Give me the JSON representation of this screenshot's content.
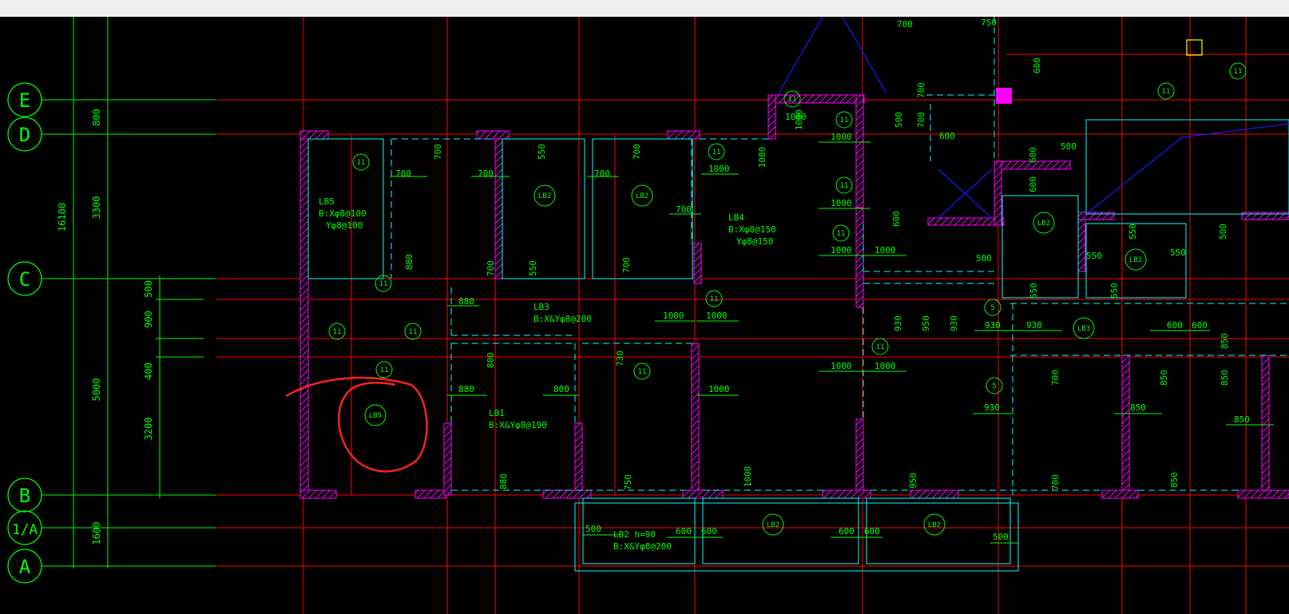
{
  "app": {
    "title": ""
  },
  "colors": {
    "background": "#000000",
    "axis": "#00ff00",
    "grid": "#ff0000",
    "wall": "#ff00ff",
    "dash": "#00ffff",
    "note": "#00ff00",
    "annotation": "#ff2222",
    "blue": "#1a1aff",
    "yellow": "#ffff00"
  },
  "axes": {
    "rows": [
      "E",
      "D",
      "C",
      "B",
      "1/A",
      "A"
    ],
    "outer_dim": "16100",
    "dims_mid": [
      "800",
      "3300",
      "5000",
      "1600"
    ],
    "dims_inner": [
      "500",
      "900",
      "400",
      "3200"
    ]
  },
  "slabs": {
    "lb5_title": "LB5",
    "lb5_x": "B:Xφ8@100",
    "lb5_y": "Yφ8@100",
    "lb4_title": "LB4",
    "lb4_x": "B:Xφ8@150",
    "lb4_y": "Yφ8@150",
    "lb3_title": "LB3",
    "lb3_x": "B:X&Yφ8@200",
    "lb1_title": "LB1",
    "lb1_x": "B:X&Yφ8@190",
    "lb2_title": "LB2  h=90",
    "lb2_x": "B:X&Yφ8@200"
  },
  "circles": {
    "lb2": "LB2",
    "lb5": "LB5",
    "lb3": "LB3",
    "n11": "11",
    "n5": "5"
  },
  "dims": {
    "d500": "500",
    "d550": "550",
    "d600": "600",
    "d700": "700",
    "d730": "730",
    "d750": "750",
    "d800": "800",
    "d850": "850",
    "d880": "880",
    "d930": "930",
    "d950": "950",
    "d1000": "1000",
    "d1080": "1080"
  }
}
